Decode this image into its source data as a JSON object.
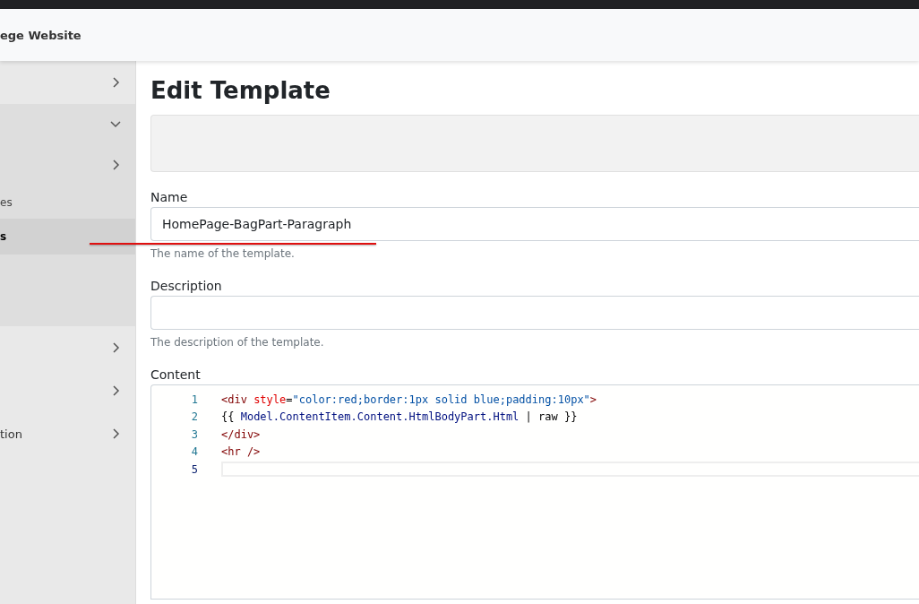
{
  "header": {
    "site_title": "ege Website"
  },
  "sidebar": {
    "items": [
      {
        "kind": "item",
        "expanded": false
      },
      {
        "kind": "group",
        "expanded": true,
        "children": [
          {
            "kind": "item",
            "expanded": false
          },
          {
            "label": "es",
            "kind": "link",
            "selected": false
          },
          {
            "label": "s",
            "kind": "link",
            "selected": true
          }
        ]
      },
      {
        "kind": "item",
        "expanded": false
      },
      {
        "kind": "item",
        "expanded": false
      },
      {
        "label": "tion",
        "kind": "item",
        "expanded": false
      }
    ]
  },
  "page": {
    "title": "Edit Template",
    "fields": [
      {
        "label": "Name",
        "value": "HomePage-BagPart-Paragraph",
        "hint": "The name of the template."
      },
      {
        "label": "Description",
        "hint": "The description of the template."
      }
    ],
    "content": {
      "label": "Content",
      "lines": [
        {
          "number": "1",
          "active": false,
          "tokens": [
            {
              "text": "<div",
              "kind": "tag"
            },
            {
              "text": " style",
              "kind": "attr"
            },
            {
              "text": "=",
              "kind": "plain"
            },
            {
              "text": "\"color:red;border:1px solid blue;padding:10px\"",
              "kind": "string"
            },
            {
              "text": ">",
              "kind": "tag"
            }
          ]
        },
        {
          "number": "2",
          "active": false,
          "tokens": [
            {
              "text": "{{ ",
              "kind": "plain"
            },
            {
              "text": "Model.ContentItem.Content.HtmlBodyPart.Html",
              "kind": "var"
            },
            {
              "text": " | raw }}",
              "kind": "plain"
            }
          ]
        },
        {
          "number": "3",
          "active": false,
          "tokens": [
            {
              "text": "</div>",
              "kind": "tag"
            }
          ]
        },
        {
          "number": "4",
          "active": false,
          "tokens": [
            {
              "text": "<hr />",
              "kind": "tag"
            }
          ]
        },
        {
          "number": "5",
          "active": true
        }
      ]
    }
  }
}
